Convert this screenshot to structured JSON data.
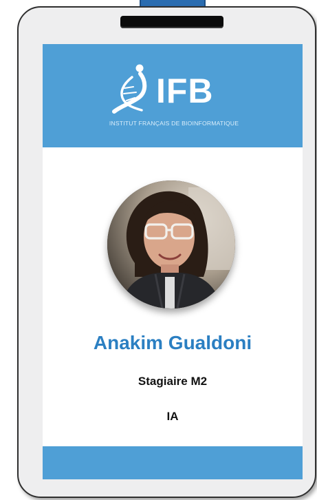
{
  "badge": {
    "logo": {
      "acronym": "IFB",
      "tagline": "INSTITUT FRANÇAIS DE BIOINFORMATIQUE"
    },
    "photo_icon": "person-portrait",
    "name": "Anakim Gualdoni",
    "role": "Stagiaire M2",
    "team": "IA"
  },
  "colors": {
    "accent": "#4f9fd6",
    "name_text": "#2b7fc2",
    "strap": "#2a6cb0",
    "card_body": "#eeeeef"
  }
}
